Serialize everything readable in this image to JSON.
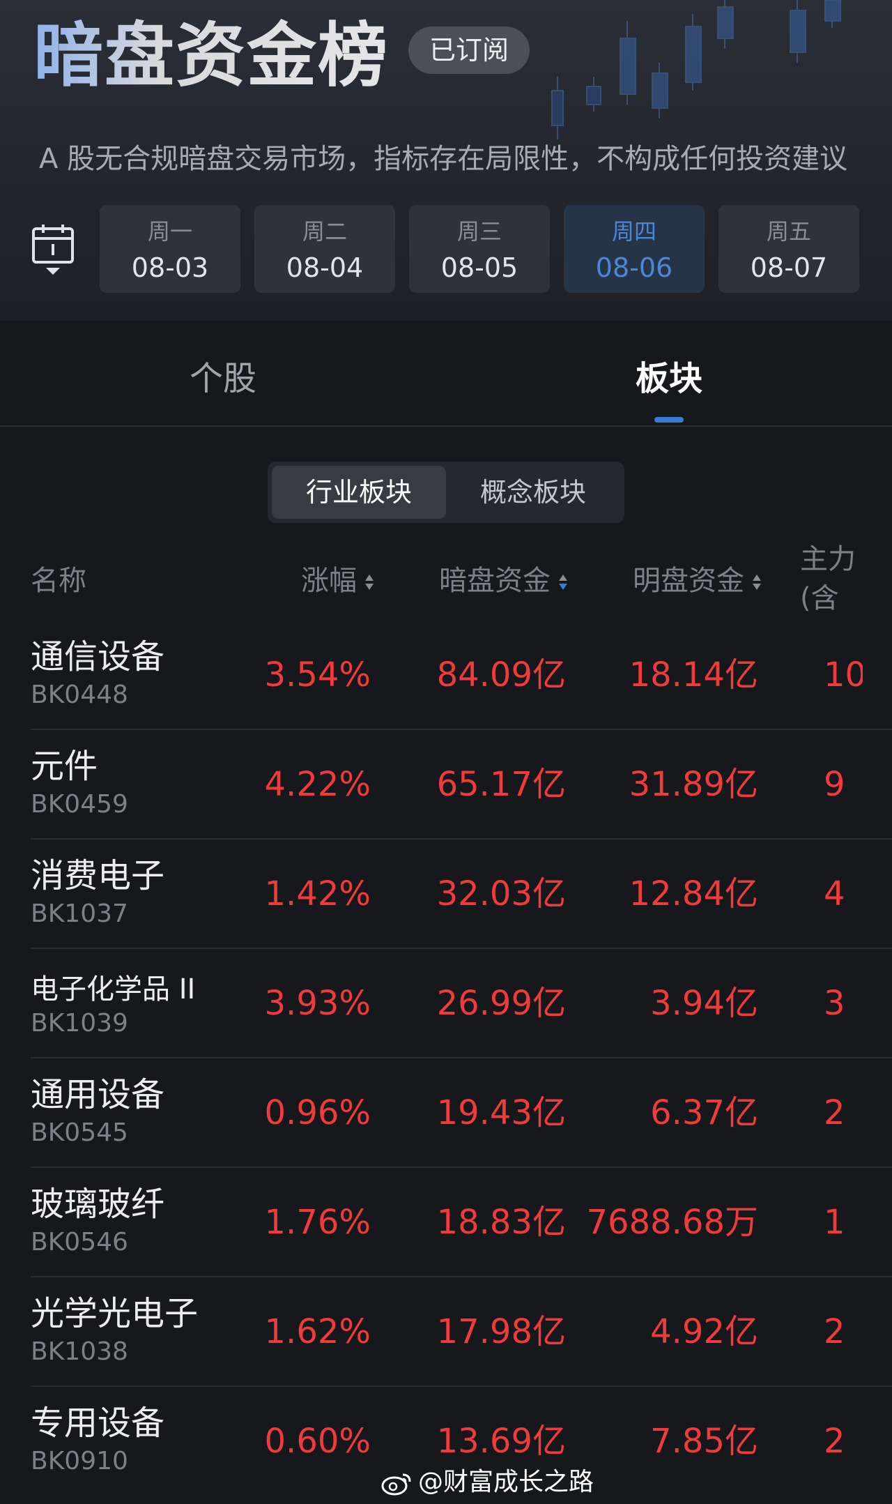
{
  "header": {
    "title": "暗盘资金榜",
    "subscribed_badge": "已订阅",
    "disclaimer": "A 股无合规暗盘交易市场，指标存在局限性，不构成任何投资建议"
  },
  "dates": [
    {
      "weekday": "周一",
      "date": "08-03"
    },
    {
      "weekday": "周二",
      "date": "08-04"
    },
    {
      "weekday": "周三",
      "date": "08-05"
    },
    {
      "weekday": "周四",
      "date": "08-06"
    },
    {
      "weekday": "周五",
      "date": "08-07"
    }
  ],
  "selected_date_index": 3,
  "main_tabs": [
    {
      "label": "个股"
    },
    {
      "label": "板块"
    }
  ],
  "selected_main_tab": 1,
  "segment_tabs": [
    {
      "label": "行业板块"
    },
    {
      "label": "概念板块"
    }
  ],
  "selected_segment": 0,
  "table": {
    "headers": {
      "name": "名称",
      "change": "涨幅",
      "dark_funds": "暗盘资金",
      "open_funds": "明盘资金",
      "main_funds_partial": "主力",
      "main_funds_partial_sub": "(含"
    },
    "rows": [
      {
        "name": "通信设备",
        "code": "BK0448",
        "change": "3.54%",
        "dark": "84.09亿",
        "open": "18.14亿",
        "main": "10"
      },
      {
        "name": "元件",
        "code": "BK0459",
        "change": "4.22%",
        "dark": "65.17亿",
        "open": "31.89亿",
        "main": "9"
      },
      {
        "name": "消费电子",
        "code": "BK1037",
        "change": "1.42%",
        "dark": "32.03亿",
        "open": "12.84亿",
        "main": "4"
      },
      {
        "name": "电子化学品 II",
        "code": "BK1039",
        "change": "3.93%",
        "dark": "26.99亿",
        "open": "3.94亿",
        "main": "3"
      },
      {
        "name": "通用设备",
        "code": "BK0545",
        "change": "0.96%",
        "dark": "19.43亿",
        "open": "6.37亿",
        "main": "2"
      },
      {
        "name": "玻璃玻纤",
        "code": "BK0546",
        "change": "1.76%",
        "dark": "18.83亿",
        "open": "7688.68万",
        "main": "1"
      },
      {
        "name": "光学光电子",
        "code": "BK1038",
        "change": "1.62%",
        "dark": "17.98亿",
        "open": "4.92亿",
        "main": "2"
      },
      {
        "name": "专用设备",
        "code": "BK0910",
        "change": "0.60%",
        "dark": "13.69亿",
        "open": "7.85亿",
        "main": "2"
      }
    ]
  },
  "watermark": "@财富成长之路",
  "colors": {
    "up_red": "#ef3b3b",
    "accent_blue": "#3a7bd5",
    "background": "#17181c"
  }
}
